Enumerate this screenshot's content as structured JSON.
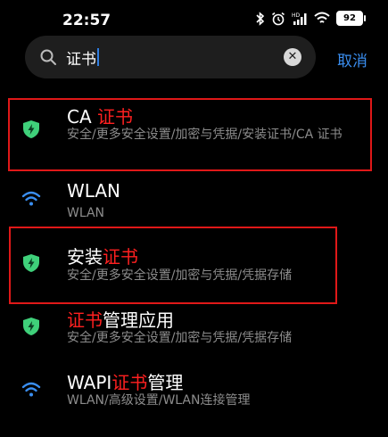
{
  "status_bar": {
    "time": "22:57",
    "battery": "92"
  },
  "search": {
    "query": "证书",
    "cancel_label": "取消"
  },
  "results": [
    {
      "icon": "shield-icon",
      "title_pre": "CA ",
      "title_hl": "证书",
      "title_post": "",
      "subtitle": "安全/更多安全设置/加密与凭据/安装证书/CA 证书"
    },
    {
      "icon": "wifi-icon",
      "title_pre": "WLAN",
      "title_hl": "",
      "title_post": "",
      "subtitle": "WLAN"
    },
    {
      "icon": "shield-icon",
      "title_pre": "安装",
      "title_hl": "证书",
      "title_post": "",
      "subtitle": "安全/更多安全设置/加密与凭据/凭据存储"
    },
    {
      "icon": "shield-icon",
      "title_pre": "",
      "title_hl": "证书",
      "title_post": "管理应用",
      "subtitle": "安全/更多安全设置/加密与凭据/凭据存储"
    },
    {
      "icon": "wifi-icon",
      "title_pre": "WAPI",
      "title_hl": "证书",
      "title_post": "管理",
      "subtitle": "WLAN/高级设置/WLAN连接管理"
    }
  ],
  "colors": {
    "accent": "#3a8ef0",
    "highlight": "#ff2020",
    "shield": "#3fd07a",
    "wifi": "#3a8ef0",
    "annotation_box": "#e01818"
  }
}
